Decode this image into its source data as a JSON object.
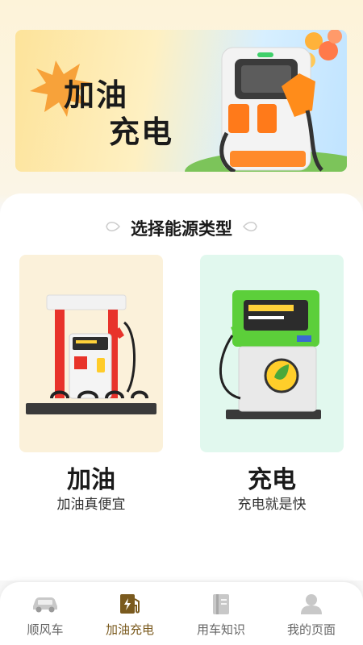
{
  "banner": {
    "title_line1": "加油",
    "title_line2": "充电"
  },
  "section": {
    "title": "选择能源类型"
  },
  "cards": [
    {
      "label": "加油",
      "subtitle": "加油真便宜"
    },
    {
      "label": "充电",
      "subtitle": "充电就是快"
    }
  ],
  "tabbar": {
    "items": [
      {
        "label": "顺风车",
        "icon": "car-icon"
      },
      {
        "label": "加油充电",
        "icon": "fuel-charge-icon",
        "active": true
      },
      {
        "label": "用车知识",
        "icon": "book-icon"
      },
      {
        "label": "我的页面",
        "icon": "user-icon"
      }
    ]
  },
  "colors": {
    "active_tab": "#7a5a1e",
    "inactive_tab": "#666666",
    "oil_card_bg": "#fbf1da",
    "ev_card_bg": "#e1f8ee"
  }
}
